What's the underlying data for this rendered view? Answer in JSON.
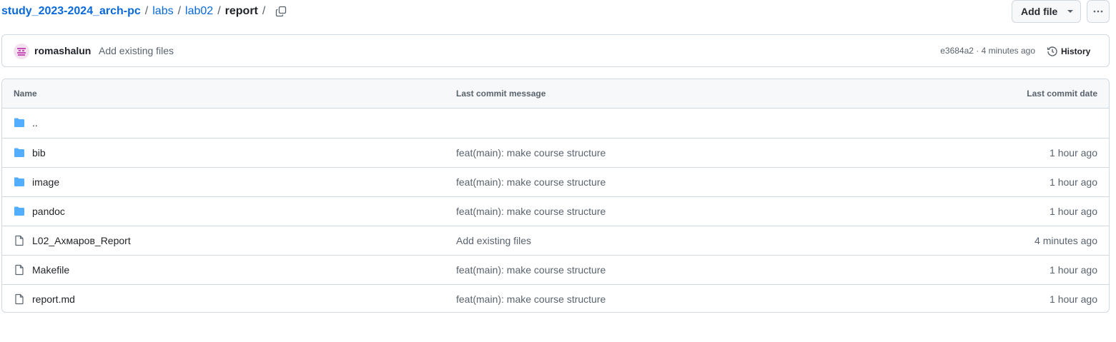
{
  "breadcrumb": {
    "repo": "study_2023-2024_arch-pc",
    "sep": "/",
    "parts": [
      "labs",
      "lab02"
    ],
    "current": "report"
  },
  "actions": {
    "add_file_label": "Add file",
    "more_label": "···"
  },
  "commit": {
    "author": "romashalun",
    "message": "Add existing files",
    "meta": "e3684a2 · 4 minutes ago",
    "history_label": "History"
  },
  "table": {
    "headers": {
      "name": "Name",
      "message": "Last commit message",
      "date": "Last commit date"
    },
    "rows": [
      {
        "type": "folder",
        "name": "..",
        "message": "",
        "date": ""
      },
      {
        "type": "folder",
        "name": "bib",
        "message": "feat(main): make course structure",
        "date": "1 hour ago"
      },
      {
        "type": "folder",
        "name": "image",
        "message": "feat(main): make course structure",
        "date": "1 hour ago"
      },
      {
        "type": "folder",
        "name": "pandoc",
        "message": "feat(main): make course structure",
        "date": "1 hour ago"
      },
      {
        "type": "file",
        "name": "L02_Ахмаров_Report",
        "message": "Add existing files",
        "date": "4 minutes ago"
      },
      {
        "type": "file",
        "name": "Makefile",
        "message": "feat(main): make course structure",
        "date": "1 hour ago"
      },
      {
        "type": "file",
        "name": "report.md",
        "message": "feat(main): make course structure",
        "date": "1 hour ago"
      }
    ]
  },
  "colors": {
    "link": "#0969da",
    "folder_icon": "#54aeff",
    "muted": "#59636e",
    "border": "#d1d9e0"
  }
}
